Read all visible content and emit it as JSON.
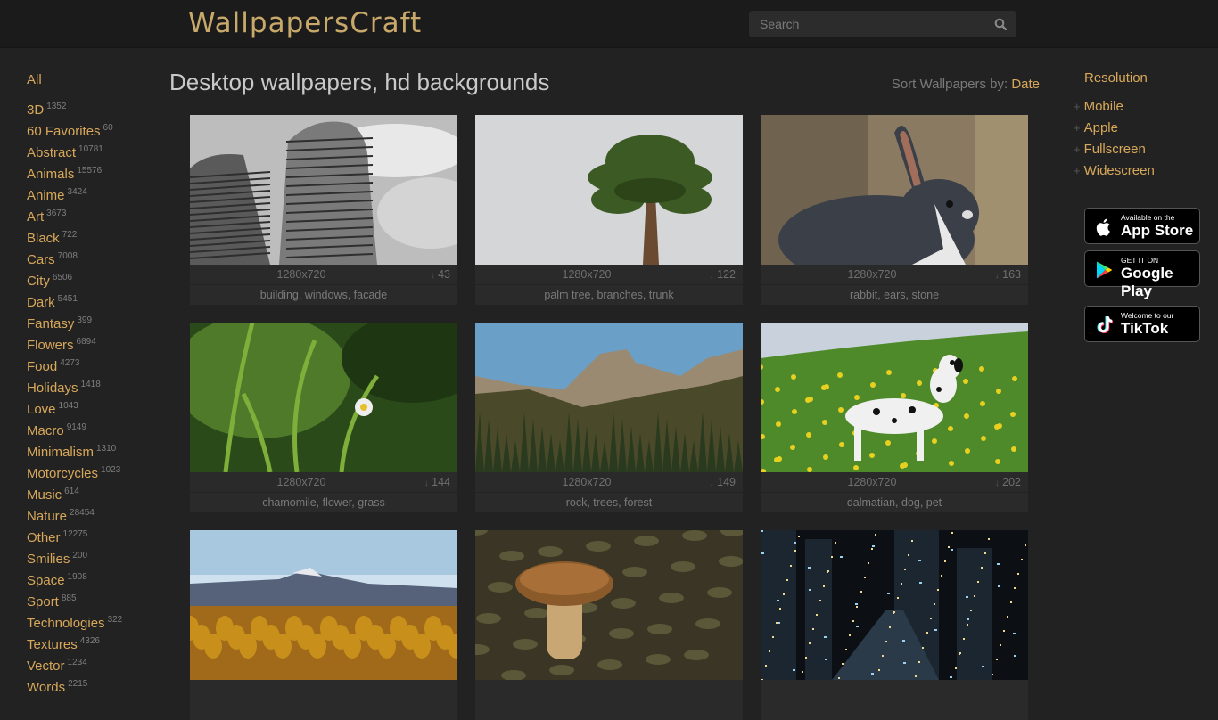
{
  "header": {
    "logo": "WallpapersCraft",
    "search_placeholder": "Search"
  },
  "categories": [
    {
      "name": "All",
      "count": ""
    },
    {
      "name": "3D",
      "count": "1352"
    },
    {
      "name": "60 Favorites",
      "count": "60"
    },
    {
      "name": "Abstract",
      "count": "10781"
    },
    {
      "name": "Animals",
      "count": "15576"
    },
    {
      "name": "Anime",
      "count": "3424"
    },
    {
      "name": "Art",
      "count": "3673"
    },
    {
      "name": "Black",
      "count": "722"
    },
    {
      "name": "Cars",
      "count": "7008"
    },
    {
      "name": "City",
      "count": "6506"
    },
    {
      "name": "Dark",
      "count": "5451"
    },
    {
      "name": "Fantasy",
      "count": "399"
    },
    {
      "name": "Flowers",
      "count": "6894"
    },
    {
      "name": "Food",
      "count": "4273"
    },
    {
      "name": "Holidays",
      "count": "1418"
    },
    {
      "name": "Love",
      "count": "1043"
    },
    {
      "name": "Macro",
      "count": "9149"
    },
    {
      "name": "Minimalism",
      "count": "1310"
    },
    {
      "name": "Motorcycles",
      "count": "1023"
    },
    {
      "name": "Music",
      "count": "614"
    },
    {
      "name": "Nature",
      "count": "28454"
    },
    {
      "name": "Other",
      "count": "12275"
    },
    {
      "name": "Smilies",
      "count": "200"
    },
    {
      "name": "Space",
      "count": "1908"
    },
    {
      "name": "Sport",
      "count": "885"
    },
    {
      "name": "Technologies",
      "count": "322"
    },
    {
      "name": "Textures",
      "count": "4326"
    },
    {
      "name": "Vector",
      "count": "1234"
    },
    {
      "name": "Words",
      "count": "2215"
    }
  ],
  "main": {
    "title": "Desktop wallpapers, hd backgrounds",
    "sort_label": "Sort Wallpapers by:",
    "sort_value": "Date"
  },
  "wallpapers": [
    {
      "resolution": "1280x720",
      "downloads": "43",
      "tags": "building, windows, facade",
      "thumb": "building"
    },
    {
      "resolution": "1280x720",
      "downloads": "122",
      "tags": "palm tree, branches, trunk",
      "thumb": "palm"
    },
    {
      "resolution": "1280x720",
      "downloads": "163",
      "tags": "rabbit, ears, stone",
      "thumb": "rabbit"
    },
    {
      "resolution": "1280x720",
      "downloads": "144",
      "tags": "chamomile, flower, grass",
      "thumb": "grass"
    },
    {
      "resolution": "1280x720",
      "downloads": "149",
      "tags": "rock, trees, forest",
      "thumb": "forest"
    },
    {
      "resolution": "1280x720",
      "downloads": "202",
      "tags": "dalmatian, dog, pet",
      "thumb": "dalmatian"
    },
    {
      "resolution": "",
      "downloads": "",
      "tags": "",
      "thumb": "autumn"
    },
    {
      "resolution": "",
      "downloads": "",
      "tags": "",
      "thumb": "mushroom"
    },
    {
      "resolution": "",
      "downloads": "",
      "tags": "",
      "thumb": "city"
    }
  ],
  "resolution_menu": {
    "title": "Resolution",
    "items": [
      "Mobile",
      "Apple",
      "Fullscreen",
      "Widescreen"
    ]
  },
  "stores": [
    {
      "small": "Available on the",
      "big": "App Store",
      "icon": "apple-icon"
    },
    {
      "small": "GET IT ON",
      "big": "Google Play",
      "icon": "google-play-icon"
    },
    {
      "small": "Welcome to our",
      "big": "TikTok",
      "icon": "tiktok-icon"
    }
  ],
  "colors": {
    "accent": "#d8a85a",
    "background": "#222222",
    "header": "#1b1b1b"
  }
}
